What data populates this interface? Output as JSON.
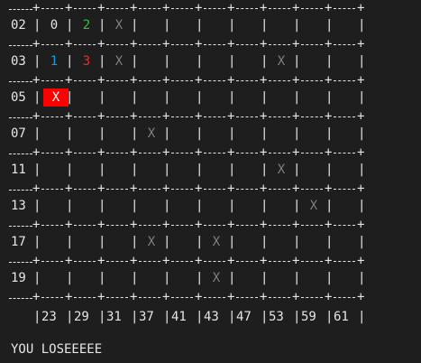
{
  "colors": {
    "background": "#1e1e1e",
    "foreground": "#e6e6e6",
    "miss": "#808080",
    "hit_bg": "#ff0000",
    "one": "#1e9bd7",
    "two": "#2cc53a",
    "three": "#e0312b",
    "zero": "#e6e6e6"
  },
  "border_line": "+---+---+---+---+---+---+---+---+---+---+",
  "rows": [
    {
      "label": "02",
      "cells": [
        "0",
        "2",
        "X",
        "",
        "",
        "",
        "",
        "",
        "",
        ""
      ],
      "kinds": [
        "zero",
        "two",
        "miss",
        "",
        "",
        "",
        "",
        "",
        "",
        ""
      ]
    },
    {
      "label": "03",
      "cells": [
        "1",
        "3",
        "X",
        "",
        "",
        "",
        "",
        "X",
        "",
        ""
      ],
      "kinds": [
        "one",
        "three",
        "miss",
        "",
        "",
        "",
        "",
        "miss",
        "",
        ""
      ]
    },
    {
      "label": "05",
      "cells": [
        "X",
        "",
        "",
        "",
        "",
        "",
        "",
        "",
        "",
        ""
      ],
      "kinds": [
        "hit",
        "",
        "",
        "",
        "",
        "",
        "",
        "",
        "",
        ""
      ]
    },
    {
      "label": "07",
      "cells": [
        "",
        "",
        "",
        "X",
        "",
        "",
        "",
        "",
        "",
        ""
      ],
      "kinds": [
        "",
        "",
        "",
        "miss",
        "",
        "",
        "",
        "",
        "",
        ""
      ]
    },
    {
      "label": "11",
      "cells": [
        "",
        "",
        "",
        "",
        "",
        "",
        "",
        "X",
        "",
        ""
      ],
      "kinds": [
        "",
        "",
        "",
        "",
        "",
        "",
        "",
        "miss",
        "",
        ""
      ]
    },
    {
      "label": "13",
      "cells": [
        "",
        "",
        "",
        "",
        "",
        "",
        "",
        "",
        "X",
        ""
      ],
      "kinds": [
        "",
        "",
        "",
        "",
        "",
        "",
        "",
        "",
        "miss",
        ""
      ]
    },
    {
      "label": "17",
      "cells": [
        "",
        "",
        "",
        "X",
        "",
        "X",
        "",
        "",
        "",
        ""
      ],
      "kinds": [
        "",
        "",
        "",
        "miss",
        "",
        "miss",
        "",
        "",
        "",
        ""
      ]
    },
    {
      "label": "19",
      "cells": [
        "",
        "",
        "",
        "",
        "",
        "X",
        "",
        "",
        "",
        ""
      ],
      "kinds": [
        "",
        "",
        "",
        "",
        "",
        "miss",
        "",
        "",
        "",
        ""
      ]
    }
  ],
  "column_labels": [
    "23",
    "29",
    "31",
    "37",
    "41",
    "43",
    "47",
    "53",
    "59",
    "61"
  ],
  "status_message": "YOU LOSEEEEE"
}
